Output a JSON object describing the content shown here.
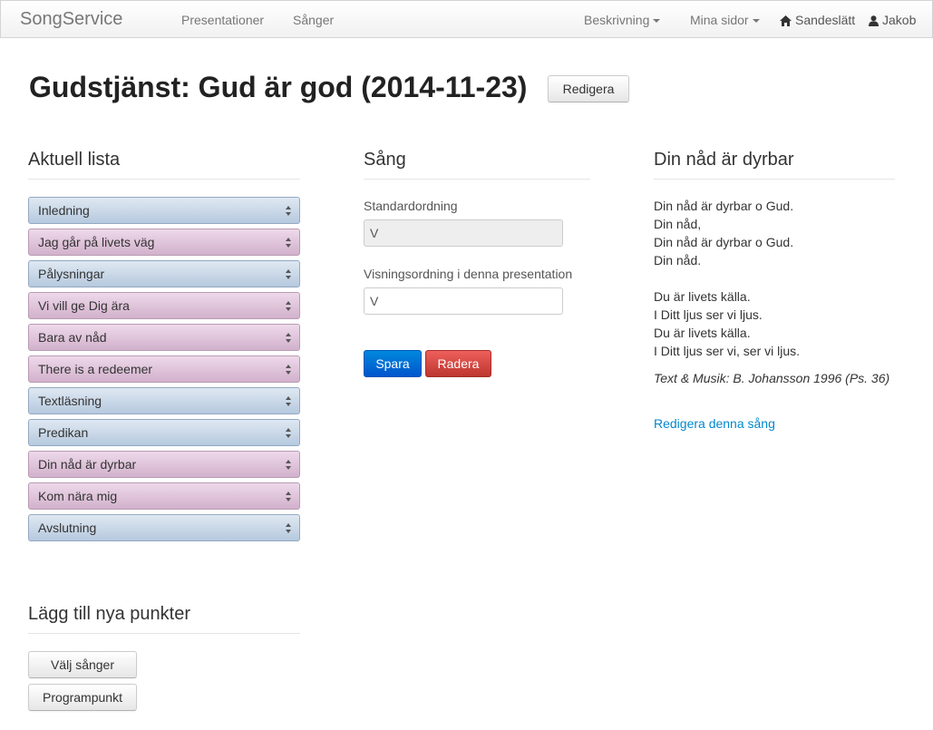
{
  "navbar": {
    "brand": "SongService",
    "links": [
      "Presentationer",
      "Sånger"
    ],
    "right": {
      "beskrivning": "Beskrivning",
      "mina_sidor": "Mina sidor",
      "location": "Sandeslätt",
      "user": "Jakob"
    }
  },
  "page": {
    "title": "Gudstjänst: Gud är god (2014-11-23)",
    "edit_button": "Redigera"
  },
  "current_list": {
    "title": "Aktuell lista",
    "items": [
      {
        "label": "Inledning",
        "kind": "blue"
      },
      {
        "label": "Jag går på livets väg",
        "kind": "pink"
      },
      {
        "label": "Pålysningar",
        "kind": "blue"
      },
      {
        "label": "Vi vill ge Dig ära",
        "kind": "pink"
      },
      {
        "label": "Bara av nåd",
        "kind": "pink"
      },
      {
        "label": "There is a redeemer",
        "kind": "pink"
      },
      {
        "label": "Textläsning",
        "kind": "blue"
      },
      {
        "label": "Predikan",
        "kind": "blue"
      },
      {
        "label": "Din nåd är dyrbar",
        "kind": "pink"
      },
      {
        "label": "Kom nära mig",
        "kind": "pink"
      },
      {
        "label": "Avslutning",
        "kind": "blue"
      }
    ]
  },
  "add_section": {
    "title": "Lägg till nya punkter",
    "choose_songs": "Välj sånger",
    "program_item": "Programpunkt"
  },
  "song": {
    "title": "Sång",
    "standard_order_label": "Standardordning",
    "standard_order_value": "V",
    "display_order_label": "Visningsordning i denna presentation",
    "display_order_value": "V",
    "save": "Spara",
    "delete": "Radera"
  },
  "lyrics": {
    "title": "Din nåd är dyrbar",
    "lines": [
      "Din nåd är dyrbar o Gud.",
      "Din nåd,",
      "Din nåd är dyrbar o Gud.",
      "Din nåd.",
      "Du är livets källa.",
      "I Ditt ljus ser vi ljus.",
      "Du är livets källa.",
      "I Ditt ljus ser vi, ser vi ljus."
    ],
    "credit": "Text & Musik: B. Johansson 1996 (Ps. 36)",
    "edit_link": "Redigera denna sång"
  },
  "icons": {
    "home": "home-icon",
    "user": "user-icon",
    "sort": "sort-icon"
  }
}
